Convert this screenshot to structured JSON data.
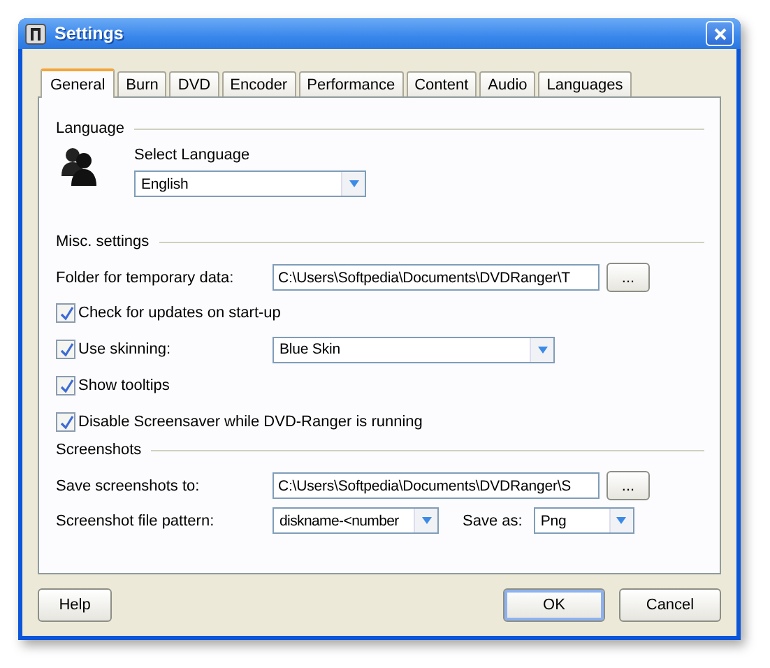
{
  "window": {
    "title": "Settings"
  },
  "tabs": [
    {
      "label": "General",
      "selected": true
    },
    {
      "label": "Burn",
      "selected": false
    },
    {
      "label": "DVD",
      "selected": false
    },
    {
      "label": "Encoder",
      "selected": false
    },
    {
      "label": "Performance",
      "selected": false
    },
    {
      "label": "Content",
      "selected": false
    },
    {
      "label": "Audio",
      "selected": false
    },
    {
      "label": "Languages",
      "selected": false
    }
  ],
  "language": {
    "heading": "Language",
    "label": "Select Language",
    "value": "English"
  },
  "misc": {
    "heading": "Misc. settings",
    "rows": [
      {
        "kind": "path",
        "label": "Folder for temporary data:",
        "value": "C:\\Users\\Softpedia\\Documents\\DVDRanger\\T",
        "button": "..."
      },
      {
        "kind": "checkbox",
        "label": "Check for updates on start-up",
        "checked": true
      },
      {
        "kind": "checkbox_select",
        "label": "Use skinning:",
        "checked": true,
        "value": "Blue Skin"
      },
      {
        "kind": "checkbox",
        "label": "Show tooltips",
        "checked": true
      },
      {
        "kind": "checkbox",
        "label": "Disable Screensaver while DVD-Ranger is running",
        "checked": true
      }
    ]
  },
  "screenshots": {
    "heading": "Screenshots",
    "rows": [
      {
        "kind": "path",
        "label": "Save screenshots to:",
        "value": "C:\\Users\\Softpedia\\Documents\\DVDRanger\\S",
        "button": "..."
      },
      {
        "kind": "select_pair",
        "label": "Screenshot file pattern:",
        "value": "diskname-<number",
        "label_2": "Save as:",
        "value_2": "Png"
      }
    ]
  },
  "buttons": [
    {
      "label": "Help",
      "default": false
    },
    {
      "label": "OK",
      "default": true
    },
    {
      "label": "Cancel",
      "default": false
    }
  ]
}
